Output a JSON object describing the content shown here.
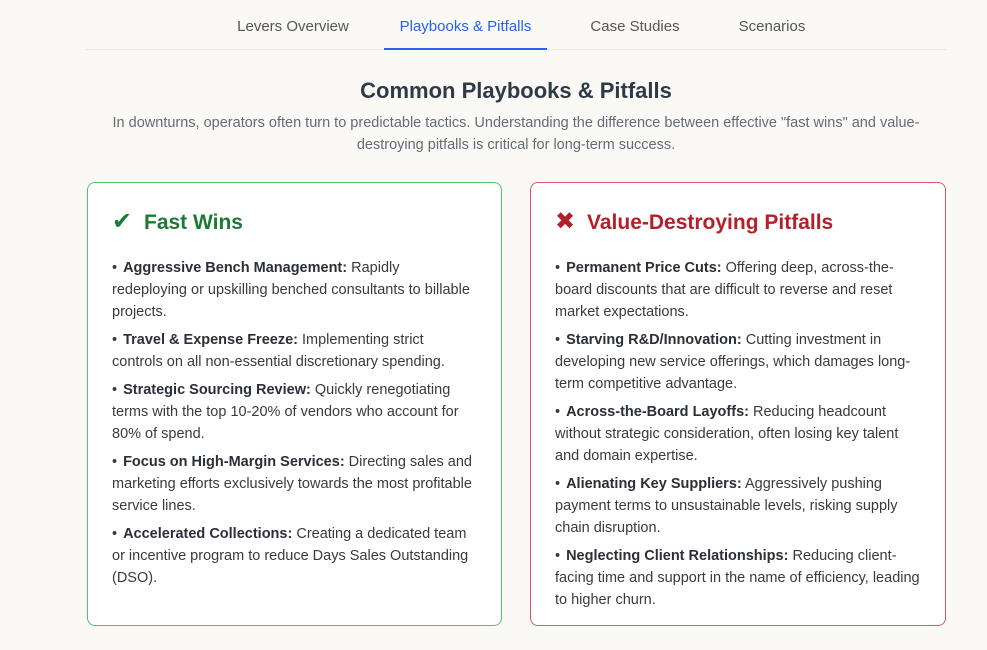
{
  "tabs": [
    {
      "label": "Levers Overview"
    },
    {
      "label": "Playbooks & Pitfalls",
      "active": true
    },
    {
      "label": "Case Studies"
    },
    {
      "label": "Scenarios"
    }
  ],
  "section": {
    "title": "Common Playbooks & Pitfalls",
    "subtitle": "In downturns, operators often turn to predictable tactics. Understanding the difference between effective \"fast wins\" and value-destroying pitfalls is critical for long-term success."
  },
  "fast_wins": {
    "icon": "check-icon",
    "icon_glyph": "✔",
    "title": "Fast Wins",
    "accent": "#1c7a35",
    "border": "#4cc76b",
    "items": [
      {
        "term": "Aggressive Bench Management:",
        "text": " Rapidly redeploying or upskilling benched consultants to billable projects."
      },
      {
        "term": "Travel & Expense Freeze:",
        "text": " Implementing strict controls on all non-essential discretionary spending."
      },
      {
        "term": "Strategic Sourcing Review:",
        "text": " Quickly renegotiating terms with the top 10-20% of vendors who account for 80% of spend."
      },
      {
        "term": "Focus on High-Margin Services:",
        "text": " Directing sales and marketing efforts exclusively towards the most profitable service lines."
      },
      {
        "term": "Accelerated Collections:",
        "text": " Creating a dedicated team or incentive program to reduce Days Sales Outstanding (DSO)."
      }
    ]
  },
  "pitfalls": {
    "icon": "x-icon",
    "icon_glyph": "✖",
    "title": "Value-Destroying Pitfalls",
    "accent": "#b3202a",
    "border": "#e0575f",
    "items": [
      {
        "term": "Permanent Price Cuts:",
        "text": " Offering deep, across-the-board discounts that are difficult to reverse and reset market expectations."
      },
      {
        "term": "Starving R&D/Innovation:",
        "text": " Cutting investment in developing new service offerings, which damages long-term competitive advantage."
      },
      {
        "term": "Across-the-Board Layoffs:",
        "text": " Reducing headcount without strategic consideration, often losing key talent and domain expertise."
      },
      {
        "term": "Alienating Key Suppliers:",
        "text": " Aggressively pushing payment terms to unsustainable levels, risking supply chain disruption."
      },
      {
        "term": "Neglecting Client Relationships:",
        "text": " Reducing client-facing time and support in the name of efficiency, leading to higher churn."
      }
    ]
  }
}
